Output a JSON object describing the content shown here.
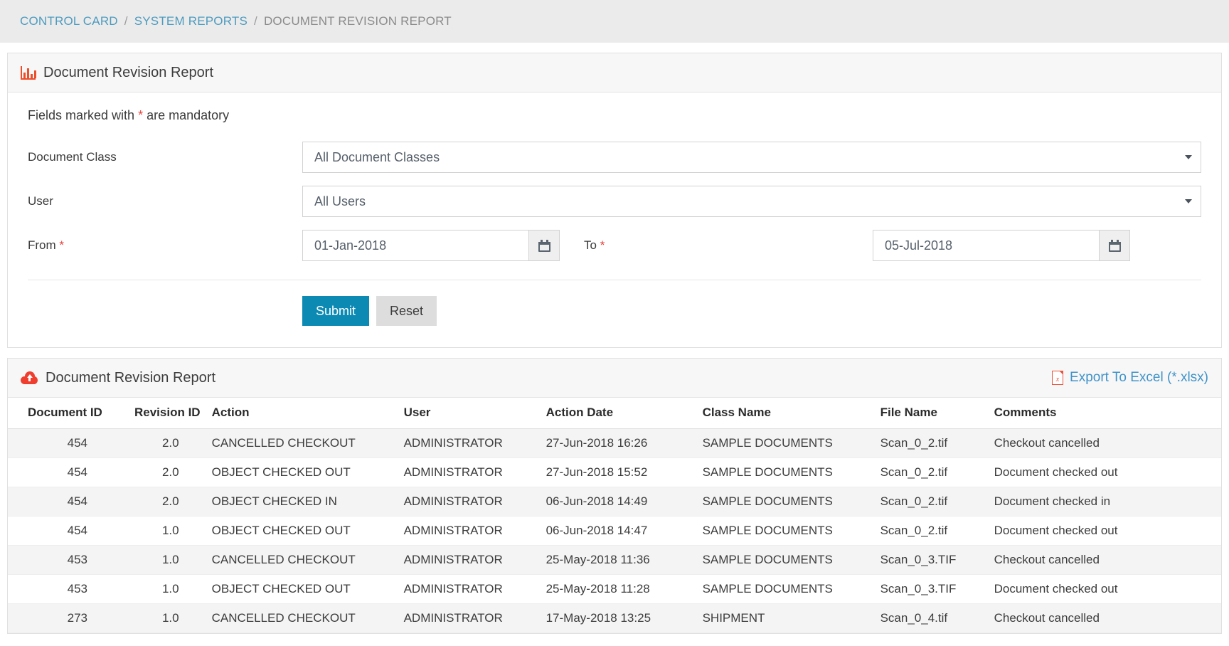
{
  "breadcrumb": {
    "items": [
      {
        "label": "CONTROL CARD",
        "current": false
      },
      {
        "label": "SYSTEM REPORTS",
        "current": false
      },
      {
        "label": "DOCUMENT REVISION REPORT",
        "current": true
      }
    ],
    "separator": "/"
  },
  "colors": {
    "accent_link": "#4d9bbf",
    "submit_bg": "#0d8ab4",
    "required_star": "#e8403a",
    "icon_red": "#ef3e2e",
    "export_link": "#3f93c9",
    "breadcrumb_bg": "#ebebeb",
    "panel_head_bg": "#f7f7f7",
    "row_stripe": "#f4f4f4"
  },
  "filter_panel": {
    "icon": "bar-chart-icon",
    "title": "Document Revision Report",
    "mandatory_note_before": "Fields marked with ",
    "mandatory_note_star": "*",
    "mandatory_note_after": " are mandatory",
    "fields": {
      "document_class": {
        "label": "Document Class",
        "value": "All Document Classes",
        "icon": "chevron-down-icon"
      },
      "user": {
        "label": "All Users",
        "label_text": "User",
        "value": "All Users",
        "icon": "chevron-down-icon"
      },
      "from": {
        "label": "From",
        "required": "*",
        "value": "01-Jan-2018",
        "icon": "calendar-icon"
      },
      "to": {
        "label": "To",
        "required": "*",
        "value": "05-Jul-2018",
        "icon": "calendar-icon"
      }
    },
    "buttons": {
      "submit": "Submit",
      "reset": "Reset"
    }
  },
  "report_panel": {
    "icon": "cloud-upload-icon",
    "title": "Document Revision Report",
    "export": {
      "icon": "excel-file-icon",
      "icon_letter": "x",
      "label": "Export To Excel (*.xlsx)"
    },
    "columns": [
      "Document ID",
      "Revision ID",
      "Action",
      "User",
      "Action Date",
      "Class Name",
      "File Name",
      "Comments"
    ],
    "rows": [
      [
        "454",
        "2.0",
        "CANCELLED CHECKOUT",
        "ADMINISTRATOR",
        "27-Jun-2018 16:26",
        "SAMPLE DOCUMENTS",
        "Scan_0_2.tif",
        "Checkout cancelled"
      ],
      [
        "454",
        "2.0",
        "OBJECT CHECKED OUT",
        "ADMINISTRATOR",
        "27-Jun-2018 15:52",
        "SAMPLE DOCUMENTS",
        "Scan_0_2.tif",
        "Document checked out"
      ],
      [
        "454",
        "2.0",
        "OBJECT CHECKED IN",
        "ADMINISTRATOR",
        "06-Jun-2018 14:49",
        "SAMPLE DOCUMENTS",
        "Scan_0_2.tif",
        "Document checked in"
      ],
      [
        "454",
        "1.0",
        "OBJECT CHECKED OUT",
        "ADMINISTRATOR",
        "06-Jun-2018 14:47",
        "SAMPLE DOCUMENTS",
        "Scan_0_2.tif",
        "Document checked out"
      ],
      [
        "453",
        "1.0",
        "CANCELLED CHECKOUT",
        "ADMINISTRATOR",
        "25-May-2018 11:36",
        "SAMPLE DOCUMENTS",
        "Scan_0_3.TIF",
        "Checkout cancelled"
      ],
      [
        "453",
        "1.0",
        "OBJECT CHECKED OUT",
        "ADMINISTRATOR",
        "25-May-2018 11:28",
        "SAMPLE DOCUMENTS",
        "Scan_0_3.TIF",
        "Document checked out"
      ],
      [
        "273",
        "1.0",
        "CANCELLED CHECKOUT",
        "ADMINISTRATOR",
        "17-May-2018 13:25",
        "SHIPMENT",
        "Scan_0_4.tif",
        "Checkout cancelled"
      ]
    ]
  }
}
